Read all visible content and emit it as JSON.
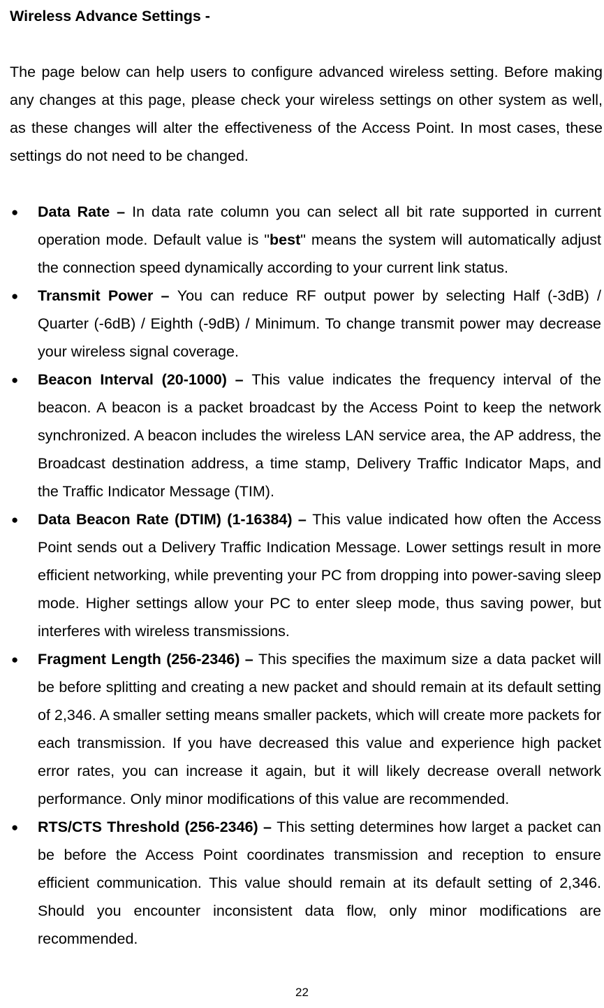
{
  "heading": "Wireless Advance Settings -",
  "intro": "The page below can help users to configure advanced wireless setting. Before making any changes at this page, please check your wireless settings on other system as well, as these changes will alter the effectiveness of the Access Point. In most cases, these settings do not need to be changed.",
  "items": [
    {
      "term": "Data Rate – ",
      "desc_before": "In data rate column you can select all bit rate supported in current operation mode. Default value is \"",
      "bold_inline": "best",
      "desc_after": "\" means the system will automatically adjust the connection speed dynamically according to your current link status."
    },
    {
      "term": "Transmit Power – ",
      "desc": "You can reduce RF output power by selecting Half (-3dB) / Quarter (-6dB) / Eighth (-9dB) / Minimum. To change transmit power may decrease your wireless signal coverage."
    },
    {
      "term": "Beacon Interval (20-1000) – ",
      "desc": "This value indicates the frequency interval of the beacon. A beacon is a packet broadcast by the Access Point to keep the network synchronized. A beacon includes the wireless LAN service area, the AP address, the Broadcast destination address, a time stamp, Delivery Traffic Indicator Maps, and the Traffic Indicator Message (TIM)."
    },
    {
      "term": "Data Beacon Rate (DTIM) (1-16384) – ",
      "desc": "This value indicated how often the Access Point sends out a Delivery Traffic Indication Message. Lower settings result in more efficient networking, while preventing your PC from dropping into power-saving sleep mode. Higher settings allow your PC to enter sleep mode, thus saving power, but interferes with wireless transmissions."
    },
    {
      "term": "Fragment Length (256-2346) – ",
      "desc": "This specifies the maximum size a data packet will be before splitting and creating a new packet and should remain at its default setting of 2,346. A smaller setting means smaller packets, which will create more packets for each transmission. If you have decreased this value and experience high packet error rates, you can increase it again, but it will likely decrease overall network performance. Only minor modifications of this value are recommended."
    },
    {
      "term": "RTS/CTS Threshold (256-2346) – ",
      "desc": "This setting determines how larget a packet can be before the Access Point coordinates transmission and reception to ensure efficient communication. This value should remain at its default setting of 2,346. Should you encounter inconsistent data flow, only minor modifications are recommended."
    }
  ],
  "page_number": "22"
}
